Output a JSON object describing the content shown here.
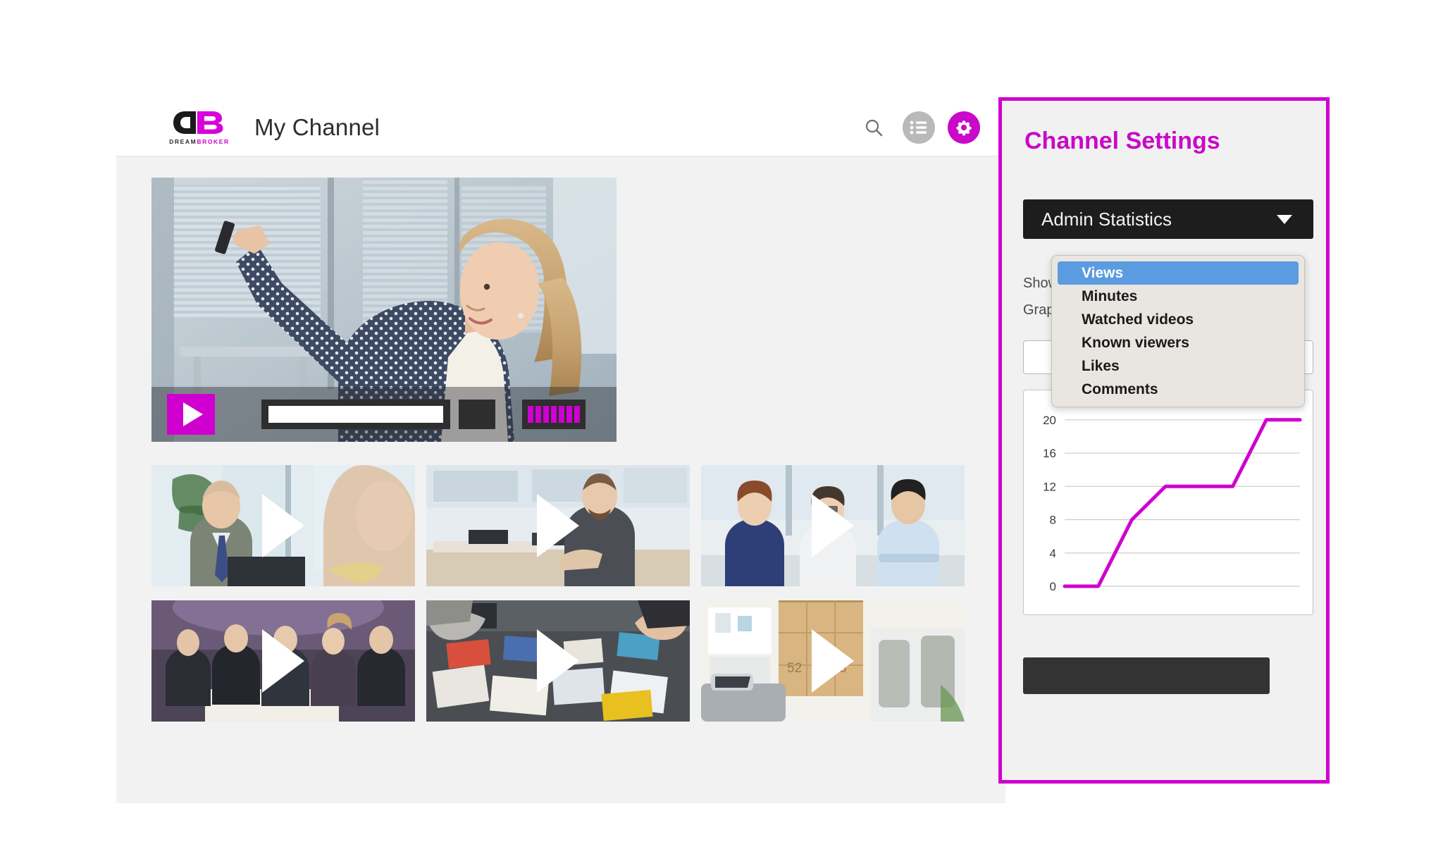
{
  "header": {
    "logo_wordmark_dream": "DREAM",
    "logo_wordmark_broker": "BROKER",
    "title": "My Channel",
    "search_icon": "search-icon",
    "playlist_icon": "playlist-icon",
    "settings_icon": "gear-icon"
  },
  "player": {
    "play_icon": "play-icon",
    "progress_label": "progress-bar",
    "time_label": "time-display",
    "volume_label": "volume-bars"
  },
  "grid": {
    "items": [
      {
        "name": "video-thumbnail-1",
        "caption": ""
      },
      {
        "name": "video-thumbnail-2",
        "caption": ""
      },
      {
        "name": "video-thumbnail-3",
        "caption": ""
      },
      {
        "name": "video-thumbnail-4",
        "caption": ""
      },
      {
        "name": "video-thumbnail-5",
        "caption": ""
      },
      {
        "name": "video-thumbnail-6",
        "caption": ""
      }
    ]
  },
  "settings": {
    "title": "Channel Settings",
    "select_value": "Admin Statistics",
    "label_show": "Show",
    "label_graph": "Graph",
    "save_label": "",
    "accent_color": "#cf00cf",
    "dropdown_options": [
      {
        "label": "Views",
        "selected": true
      },
      {
        "label": "Minutes",
        "selected": false
      },
      {
        "label": "Watched videos",
        "selected": false
      },
      {
        "label": "Known viewers",
        "selected": false
      },
      {
        "label": "Likes",
        "selected": false
      },
      {
        "label": "Comments",
        "selected": false
      }
    ]
  },
  "chart_data": {
    "type": "line",
    "title": "",
    "xlabel": "",
    "ylabel": "",
    "ylim": [
      0,
      21
    ],
    "yticks": [
      0,
      4,
      8,
      12,
      16,
      20
    ],
    "ytick_labels": [
      "0",
      "4",
      "8",
      "12",
      "16",
      "20"
    ],
    "grid": true,
    "legend": "none",
    "line_color": "#cf00cf",
    "x": [
      0,
      1,
      2,
      3,
      4,
      5,
      6,
      7
    ],
    "values": [
      0,
      0,
      8,
      12,
      12,
      12,
      20,
      20
    ],
    "series": [
      {
        "name": "Views",
        "values": [
          0,
          0,
          8,
          12,
          12,
          12,
          20,
          20
        ]
      }
    ]
  }
}
